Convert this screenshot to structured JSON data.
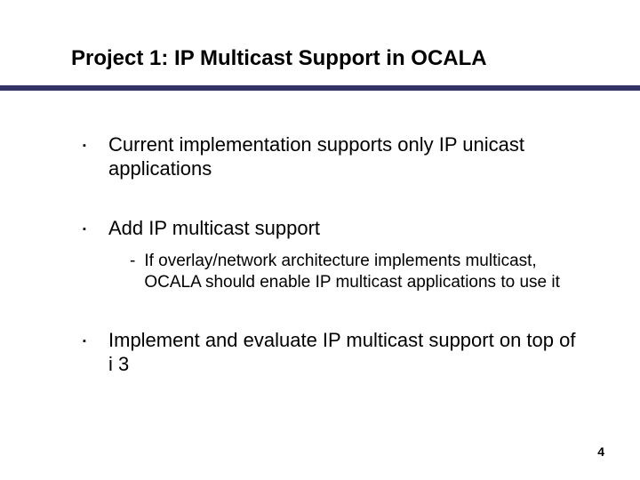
{
  "slide": {
    "title": "Project 1: IP Multicast Support in OCALA",
    "bullets": [
      {
        "text": "Current implementation supports only IP unicast applications",
        "sub": []
      },
      {
        "text": "Add IP multicast support",
        "sub": [
          "If overlay/network architecture implements multicast, OCALA should enable IP multicast applications to use it"
        ]
      },
      {
        "text": "Implement and evaluate IP multicast support on top of i 3",
        "sub": []
      }
    ],
    "page_number": "4"
  }
}
